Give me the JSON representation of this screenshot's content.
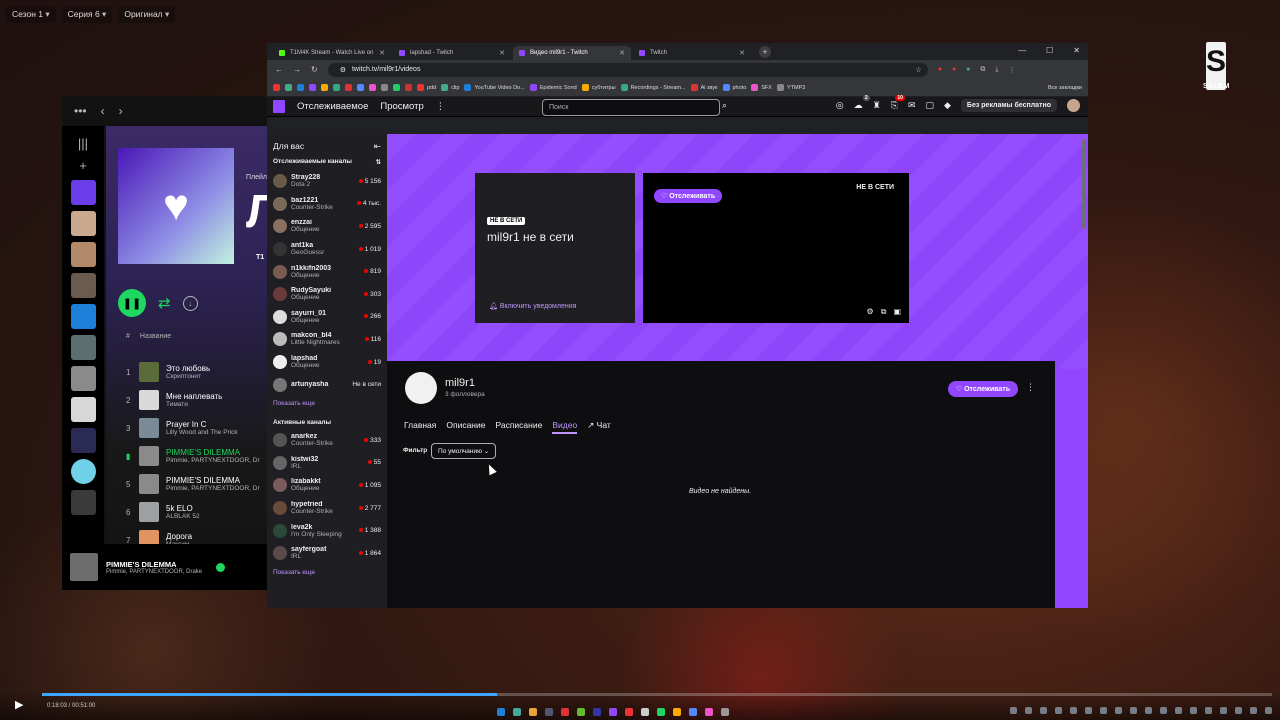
{
  "player_menus": [
    "Сезон 1",
    "Серия 6",
    "Оригинал"
  ],
  "logo": {
    "letter": "S",
    "text": "SALEM"
  },
  "spotify": {
    "playlist_label": "Плейл",
    "playlist_big": "Л",
    "playlist_meta": "Т1",
    "col_number": "#",
    "col_title": "Название",
    "tracks": [
      {
        "n": "1",
        "title": "Это любовь",
        "artist": "Скриптонит",
        "color": "#5b6b3a"
      },
      {
        "n": "2",
        "title": "Мне наплевать",
        "artist": "Тимати",
        "color": "#d9d9d9"
      },
      {
        "n": "3",
        "title": "Prayer In C",
        "artist": "Lilly Wood and The Prick",
        "color": "#7a8a96"
      },
      {
        "n": "4",
        "title": "PIMMIE'S DILEMMA",
        "artist": "Pimmie, PARTYNEXTDOOR, Dr",
        "color": "#8a8a8a",
        "playing": true
      },
      {
        "n": "5",
        "title": "PIMMIE'S DILEMMA",
        "artist": "Pimmie, PARTYNEXTDOOR, Dr",
        "color": "#8a8a8a"
      },
      {
        "n": "6",
        "title": "5k ELO",
        "artist": "ALBLAK 52",
        "color": "#9da0a3"
      },
      {
        "n": "7",
        "title": "Дорога",
        "artist": "Максим",
        "color": "#e29460"
      }
    ],
    "now_playing": {
      "title": "PIMMIE'S DILEMMA",
      "artist": "Pimmie, PARTYNEXTDOOR, Drake"
    }
  },
  "chrome": {
    "tabs": [
      {
        "title": "T1M4K Stream - Watch Live on",
        "color": "#53fc18",
        "active": false
      },
      {
        "title": "lapshad - Twitch",
        "color": "#9147ff",
        "active": false
      },
      {
        "title": "Видео mil9r1 - Twitch",
        "color": "#9147ff",
        "active": true
      },
      {
        "title": "Twitch",
        "color": "#9147ff",
        "active": false
      }
    ],
    "url": "twitch.tv/mil9r1/videos",
    "bookmarks": [
      "pdd",
      "clip",
      "YouTube Video Do...",
      "Epidemic Sond",
      "субтитры",
      "Recordings - Stream...",
      "Ai звук",
      "photo",
      "SFX",
      "YTMP3"
    ],
    "all_bookmarks": "Все закладки"
  },
  "twitch": {
    "nav_following": "Отслеживаемое",
    "nav_browse": "Просмотр",
    "search_placeholder": "Поиск",
    "badge_1": "2",
    "badge_2": "10",
    "no_ads": "Без рекламы бесплатно",
    "sidebar": {
      "for_you": "Для вас",
      "followed_title": "Отслеживаемые каналы",
      "followed": [
        {
          "name": "Stray228",
          "game": "Dota 2",
          "viewers": "5 156",
          "color": "#6a5a4a"
        },
        {
          "name": "baz1221",
          "game": "Counter-Strike",
          "viewers": "4 тыс.",
          "color": "#7a6a5a"
        },
        {
          "name": "enzzai",
          "game": "Общение",
          "viewers": "2 595",
          "color": "#8a7060"
        },
        {
          "name": "ant1ka",
          "game": "GeoGuessr",
          "viewers": "1 019",
          "color": "#333"
        },
        {
          "name": "n1kkifn2003",
          "game": "Общение",
          "viewers": "819",
          "color": "#7a5a50"
        },
        {
          "name": "RudySayuki",
          "game": "Общение",
          "viewers": "303",
          "color": "#6a3a3a"
        },
        {
          "name": "sayurri_01",
          "game": "Общение",
          "viewers": "266",
          "color": "#ddd"
        },
        {
          "name": "makcon_bl4",
          "game": "Little Nightmares",
          "viewers": "116",
          "color": "#bbb"
        },
        {
          "name": "lapshad",
          "game": "Общение",
          "viewers": "19",
          "color": "#eee"
        },
        {
          "name": "artunyasha",
          "game": "",
          "viewers": "Не в сети",
          "color": "#777",
          "offline": true
        }
      ],
      "show_more_1": "Показать еще",
      "active_title": "Активные каналы",
      "active": [
        {
          "name": "anarkez",
          "game": "Counter-Strike",
          "viewers": "333",
          "color": "#555"
        },
        {
          "name": "kistwi32",
          "game": "IRL",
          "viewers": "55",
          "color": "#666"
        },
        {
          "name": "lizabakkt",
          "game": "Общение",
          "viewers": "1 095",
          "color": "#7a5a5a"
        },
        {
          "name": "hypetried",
          "game": "Counter-Strike",
          "viewers": "2 777",
          "color": "#6a4a3a"
        },
        {
          "name": "leva2k",
          "game": "I'm Only Sleeping",
          "viewers": "1 388",
          "color": "#2a4a3a"
        },
        {
          "name": "sayfergoat",
          "game": "IRL",
          "viewers": "1 864",
          "color": "#5a4a4a"
        }
      ],
      "show_more_2": "Показать еще"
    },
    "offline_badge": "НЕ В СЕТИ",
    "offline_text": "mil9r1 не в сети",
    "notify": "Включить уведомления",
    "follow": "Отслеживать",
    "player_offline": "НЕ В СЕТИ",
    "channel": {
      "name": "mil9r1",
      "followers": "3 фолловера",
      "tabs": [
        "Главная",
        "Описание",
        "Расписание",
        "Видео",
        "Чат"
      ],
      "active_tab": "Видео",
      "filter_label": "Фильтр",
      "filter_value": "По умолчанию",
      "empty": "Видео не найдены."
    }
  },
  "video": {
    "time": "0:18:03 / 00:51:00",
    "progress": 0.37
  },
  "colors": {
    "twitch_purple": "#9147ff",
    "spotify_green": "#1ed760",
    "dark": "#0e0e10"
  }
}
